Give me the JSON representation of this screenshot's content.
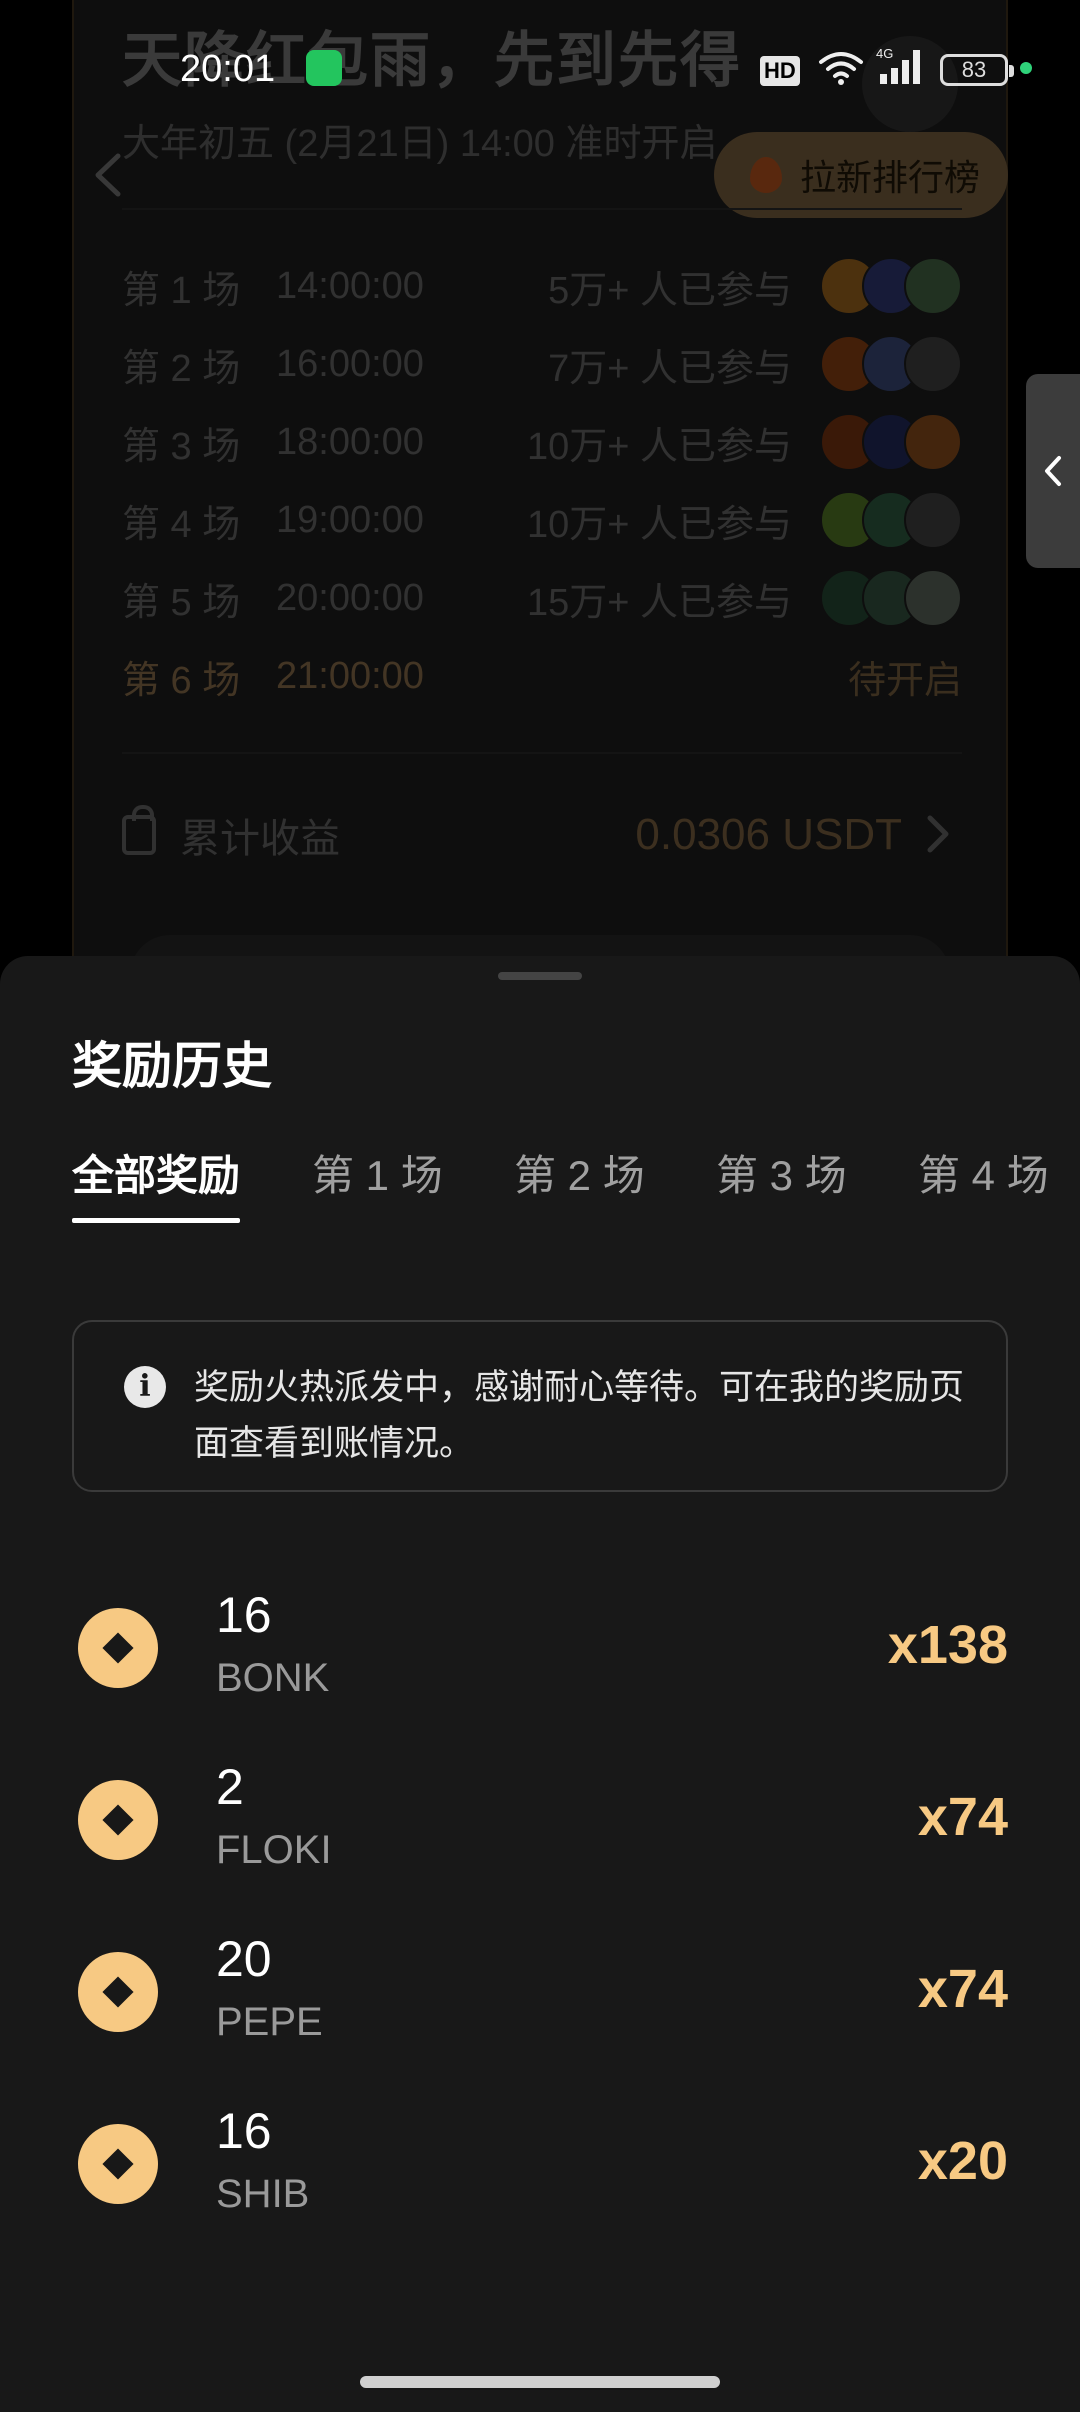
{
  "status_bar": {
    "time": "20:01",
    "hd": "HD",
    "network": "4G",
    "battery": "83"
  },
  "promo": {
    "title": "天降红包雨，先到先得",
    "subtitle": "大年初五 (2月21日) 14:00 准时开启",
    "rank_button": "拉新排行榜"
  },
  "rounds": [
    {
      "label": "第 1 场",
      "time": "14:00:00",
      "participants": "5万+ 人已参与"
    },
    {
      "label": "第 2 场",
      "time": "16:00:00",
      "participants": "7万+ 人已参与"
    },
    {
      "label": "第 3 场",
      "time": "18:00:00",
      "participants": "10万+ 人已参与"
    },
    {
      "label": "第 4 场",
      "time": "19:00:00",
      "participants": "10万+ 人已参与"
    },
    {
      "label": "第 5 场",
      "time": "20:00:00",
      "participants": "15万+ 人已参与"
    },
    {
      "label": "第 6 场",
      "time": "21:00:00",
      "status": "待开启"
    }
  ],
  "earnings": {
    "label": "累计收益",
    "value": "0.0306 USDT"
  },
  "sheet": {
    "title": "奖励历史",
    "tabs": [
      "全部奖励",
      "第 1 场",
      "第 2 场",
      "第 3 场",
      "第 4 场"
    ],
    "notice": "奖励火热派发中，感谢耐心等待。可在我的奖励页面查看到账情况。",
    "rewards": [
      {
        "amount": "16",
        "token": "BONK",
        "multiplier": "x138"
      },
      {
        "amount": "2",
        "token": "FLOKI",
        "multiplier": "x74"
      },
      {
        "amount": "20",
        "token": "PEPE",
        "multiplier": "x74"
      },
      {
        "amount": "16",
        "token": "SHIB",
        "multiplier": "x20"
      }
    ]
  },
  "colors": {
    "accent": "#f7c983",
    "sheet_bg": "#181818",
    "app_bg": "#000000"
  }
}
